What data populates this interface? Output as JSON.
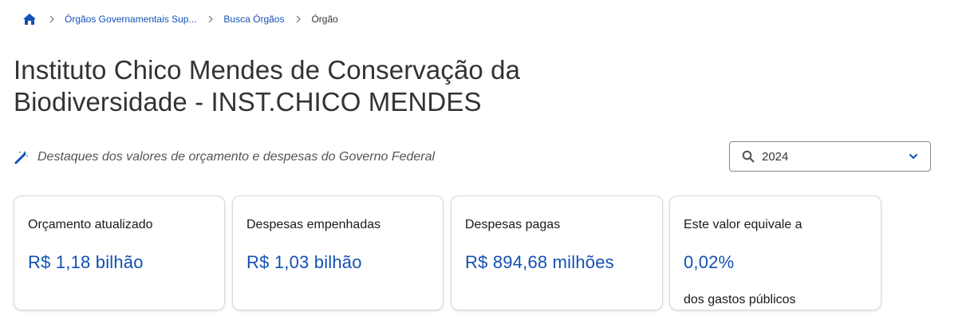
{
  "breadcrumb": {
    "home_icon": "home-icon",
    "items": [
      {
        "label": "Órgãos Governamentais Sup...",
        "link": true
      },
      {
        "label": "Busca Órgãos",
        "link": true
      },
      {
        "label": "Órgão",
        "link": false
      }
    ]
  },
  "title": "Instituto Chico Mendes de Conservação da Biodiversidade - INST.CHICO MENDES",
  "subtitle": {
    "icon": "magic-wand-icon",
    "text": "Destaques dos valores de orçamento e despesas do Governo Federal"
  },
  "year_select": {
    "icon": "search-icon",
    "value": "2024",
    "chevron": "chevron-down-icon"
  },
  "cards": [
    {
      "label": "Orçamento atualizado",
      "value": "R$ 1,18 bilhão"
    },
    {
      "label": "Despesas empenhadas",
      "value": "R$ 1,03 bilhão"
    },
    {
      "label": "Despesas pagas",
      "value": "R$ 894,68 milhões"
    },
    {
      "label": "Este valor equivale a",
      "value": "0,02%",
      "note": "dos gastos públicos"
    }
  ],
  "colors": {
    "link": "#1351b4",
    "text": "#333333",
    "border": "#d9d9d9"
  }
}
